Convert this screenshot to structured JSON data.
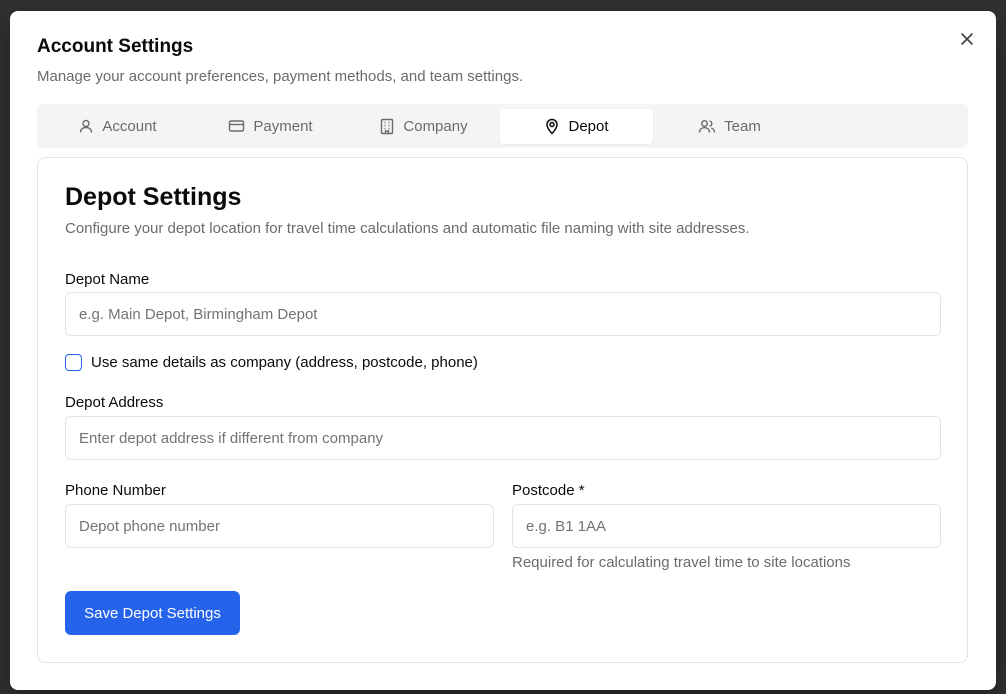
{
  "dialog": {
    "title": "Account Settings",
    "subtitle": "Manage your account preferences, payment methods, and team settings.",
    "close_icon": "close-icon"
  },
  "tabs": [
    {
      "label": "Account",
      "icon": "user-icon",
      "active": false
    },
    {
      "label": "Payment",
      "icon": "credit-card-icon",
      "active": false
    },
    {
      "label": "Company",
      "icon": "building-icon",
      "active": false
    },
    {
      "label": "Depot",
      "icon": "map-pin-icon",
      "active": true
    },
    {
      "label": "Team",
      "icon": "users-icon",
      "active": false
    }
  ],
  "depot": {
    "title": "Depot Settings",
    "description": "Configure your depot location for travel time calculations and automatic file naming with site addresses.",
    "name_label": "Depot Name",
    "name_value": "",
    "name_placeholder": "e.g. Main Depot, Birmingham Depot",
    "same_details_label": "Use same details as company (address, postcode, phone)",
    "same_details_checked": false,
    "address_label": "Depot Address",
    "address_value": "",
    "address_placeholder": "Enter depot address if different from company",
    "phone_label": "Phone Number",
    "phone_value": "",
    "phone_placeholder": "Depot phone number",
    "postcode_label": "Postcode *",
    "postcode_value": "",
    "postcode_placeholder": "e.g. B1 1AA",
    "postcode_helper": "Required for calculating travel time to site locations",
    "save_label": "Save Depot Settings"
  },
  "colors": {
    "accent": "#2563eb",
    "muted_text": "#6b6b6b",
    "border": "#e4e4e7",
    "tab_bg": "#f4f4f5"
  }
}
